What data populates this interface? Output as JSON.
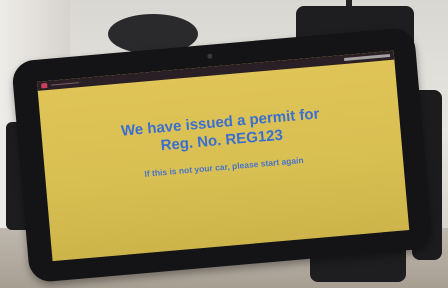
{
  "screen": {
    "headline_line1": "We have issued a permit for",
    "headline_line2": "Reg. No. REG123",
    "subline": "If this is not your car, please start again"
  },
  "colors": {
    "screen_background": "#d8bf52",
    "text_blue": "#3b6fcf"
  }
}
